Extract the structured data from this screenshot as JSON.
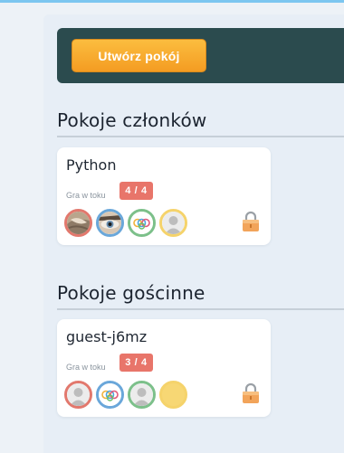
{
  "header": {
    "create_room_label": "Utwórz pokój"
  },
  "sections": [
    {
      "title": "Pokoje członków",
      "room": {
        "name": "Python",
        "status": "Gra w toku",
        "count": "4 / 4",
        "avatars": [
          {
            "kind": "photo-face",
            "ring": "#e2786d"
          },
          {
            "kind": "photo-eye",
            "ring": "#6aa7da"
          },
          {
            "kind": "rings-logo",
            "ring": "#7cc08a"
          },
          {
            "kind": "default-person",
            "ring": "#f5d36b"
          }
        ],
        "locked": true
      }
    },
    {
      "title": "Pokoje gościnne",
      "room": {
        "name": "guest-j6mz",
        "status": "Gra w toku",
        "count": "3 / 4",
        "avatars": [
          {
            "kind": "default-person",
            "ring": "#e2786d"
          },
          {
            "kind": "rings-logo",
            "ring": "#6aa7da"
          },
          {
            "kind": "default-person",
            "ring": "#7cc08a"
          },
          {
            "kind": "empty-slot",
            "ring": "#f5d36b"
          }
        ],
        "locked": true
      }
    }
  ],
  "colors": {
    "banner": "#2b4b4e",
    "accent_orange": "#f49c22",
    "badge_red": "#e8756a",
    "page_bg": "#edf2f7"
  }
}
